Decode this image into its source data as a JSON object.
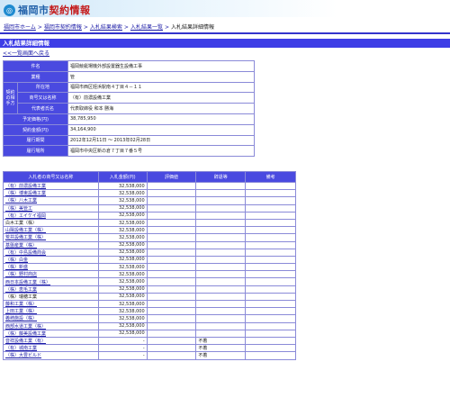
{
  "header": {
    "logo_text_city": "福岡市",
    "logo_text_main": "契約情報"
  },
  "breadcrumb": {
    "items": [
      "福岡市ホーム",
      "福岡市契約情報",
      "入札結果検索",
      "入札結果一覧"
    ],
    "current": "入札結果詳細情報",
    "separator": ">"
  },
  "page_title": "入札結果詳細情報",
  "back_link": "<<一覧画面へ戻る",
  "info": {
    "subject_label": "件名",
    "subject": "福岡競艇場機外部設置器生設備工事",
    "category_label": "業種",
    "category": "管",
    "contractor_group_label": "契約の相手方",
    "address_label": "所在地",
    "address": "福岡市西区姪浜駅南４丁目４－１１",
    "company_label": "商号又は名称",
    "company": "（有）前濃設備工業",
    "rep_label": "代表者氏名",
    "rep": "代表取締役 和本 勝海",
    "planned_label": "予定価格(円)",
    "planned": "38,785,950",
    "contract_label": "契約金額(円)",
    "contract": "34,164,900",
    "period_label": "履行期間",
    "period": "2012年12月11日 ～ 2013年02月28日",
    "place_label": "履行場所",
    "place": "福岡市中央区新の倉７丁目７番５号"
  },
  "bids": {
    "headers": [
      "入札者の商号又は名称",
      "入札金額(円)",
      "評価値",
      "辞退等",
      "備考"
    ],
    "rows": [
      {
        "name": "（有）前濃設備工業",
        "link": true,
        "amount": "32,538,000",
        "eval": "",
        "status": "",
        "note": ""
      },
      {
        "name": "（株）博東設備工業",
        "link": true,
        "amount": "32,538,000",
        "eval": "",
        "status": "",
        "note": ""
      },
      {
        "name": "（株）八木工業",
        "link": true,
        "amount": "32,538,000",
        "eval": "",
        "status": "",
        "note": ""
      },
      {
        "name": "（株）美管工",
        "link": true,
        "amount": "32,538,000",
        "eval": "",
        "status": "",
        "note": ""
      },
      {
        "name": "（有）エイケイ福岡",
        "link": true,
        "amount": "32,538,000",
        "eval": "",
        "status": "",
        "note": ""
      },
      {
        "name": "白木工業（株）",
        "link": false,
        "amount": "32,538,000",
        "eval": "",
        "status": "",
        "note": ""
      },
      {
        "name": "山陽設備工業（株）",
        "link": true,
        "amount": "32,538,000",
        "eval": "",
        "status": "",
        "note": ""
      },
      {
        "name": "荒井設備工業（株）",
        "link": true,
        "amount": "32,538,000",
        "eval": "",
        "status": "",
        "note": ""
      },
      {
        "name": "基盤産業（株）",
        "link": true,
        "amount": "32,538,000",
        "eval": "",
        "status": "",
        "note": ""
      },
      {
        "name": "（有）中島設備商会",
        "link": true,
        "amount": "32,538,000",
        "eval": "",
        "status": "",
        "note": ""
      },
      {
        "name": "（株）白金",
        "link": true,
        "amount": "32,538,000",
        "eval": "",
        "status": "",
        "note": ""
      },
      {
        "name": "（株）新盛",
        "link": true,
        "amount": "32,538,000",
        "eval": "",
        "status": "",
        "note": ""
      },
      {
        "name": "（株）野村商店",
        "link": true,
        "amount": "32,538,000",
        "eval": "",
        "status": "",
        "note": ""
      },
      {
        "name": "西日本設備工業（株）",
        "link": true,
        "amount": "32,538,000",
        "eval": "",
        "status": "",
        "note": ""
      },
      {
        "name": "（株）恵毛工業",
        "link": true,
        "amount": "32,538,000",
        "eval": "",
        "status": "",
        "note": ""
      },
      {
        "name": "（株）瑞穂工業",
        "link": false,
        "amount": "32,538,000",
        "eval": "",
        "status": "",
        "note": ""
      },
      {
        "name": "藤和工業（株）",
        "link": true,
        "amount": "32,538,000",
        "eval": "",
        "status": "",
        "note": ""
      },
      {
        "name": "上田工業（株）",
        "link": true,
        "amount": "32,538,000",
        "eval": "",
        "status": "",
        "note": ""
      },
      {
        "name": "義崎施設（株）",
        "link": true,
        "amount": "32,538,000",
        "eval": "",
        "status": "",
        "note": ""
      },
      {
        "name": "西部水道工業（株）",
        "link": true,
        "amount": "32,538,000",
        "eval": "",
        "status": "",
        "note": ""
      },
      {
        "name": "（株）藤美設備工業",
        "link": true,
        "amount": "32,538,000",
        "eval": "",
        "status": "",
        "note": ""
      },
      {
        "name": "音祥設備工業（有）",
        "link": true,
        "amount": "-",
        "eval": "",
        "status": "不着",
        "note": ""
      },
      {
        "name": "（有）城南工業",
        "link": true,
        "amount": "-",
        "eval": "",
        "status": "不着",
        "note": ""
      },
      {
        "name": "（株）大豊ビルド",
        "link": true,
        "amount": "-",
        "eval": "",
        "status": "不着",
        "note": ""
      }
    ]
  }
}
